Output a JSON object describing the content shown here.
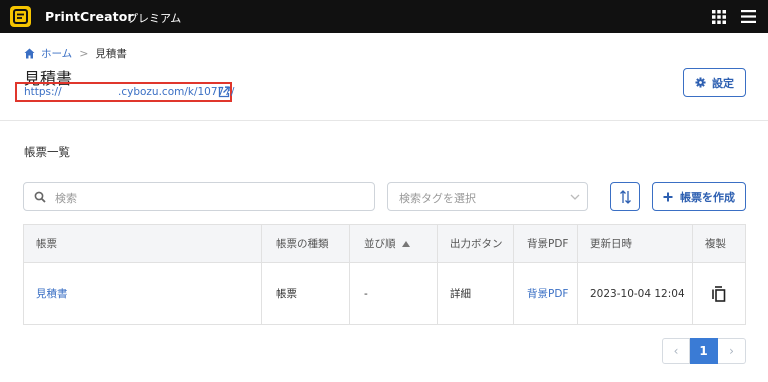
{
  "header": {
    "brand": "PrintCreator",
    "plan": "プレミアム"
  },
  "breadcrumb": {
    "home": "ホーム",
    "separator": ">",
    "current": "見積書"
  },
  "page": {
    "title": "見積書",
    "url_start": "https://",
    "url_end": ".cybozu.com/k/10777/",
    "settings_label": "設定"
  },
  "section": {
    "title": "帳票一覧"
  },
  "filters": {
    "search_placeholder": "検索",
    "tag_placeholder": "検索タグを選択",
    "create_label": "帳票を作成"
  },
  "table": {
    "columns": [
      "帳票",
      "帳票の種類",
      "並び順",
      "出力ボタン",
      "背景PDF",
      "更新日時",
      "複製"
    ],
    "rows": [
      {
        "name": "見積書",
        "type": "帳票",
        "order": "-",
        "output": "詳細",
        "bg_pdf": "背景PDF",
        "updated": "2023-10-04 12:04"
      }
    ]
  },
  "pagination": {
    "prev": "‹",
    "current": "1",
    "next": "›"
  },
  "colors": {
    "accent": "#3a6fc4",
    "topbar": "#111111",
    "logo": "#f5c400",
    "highlight_border": "#e0362c"
  }
}
